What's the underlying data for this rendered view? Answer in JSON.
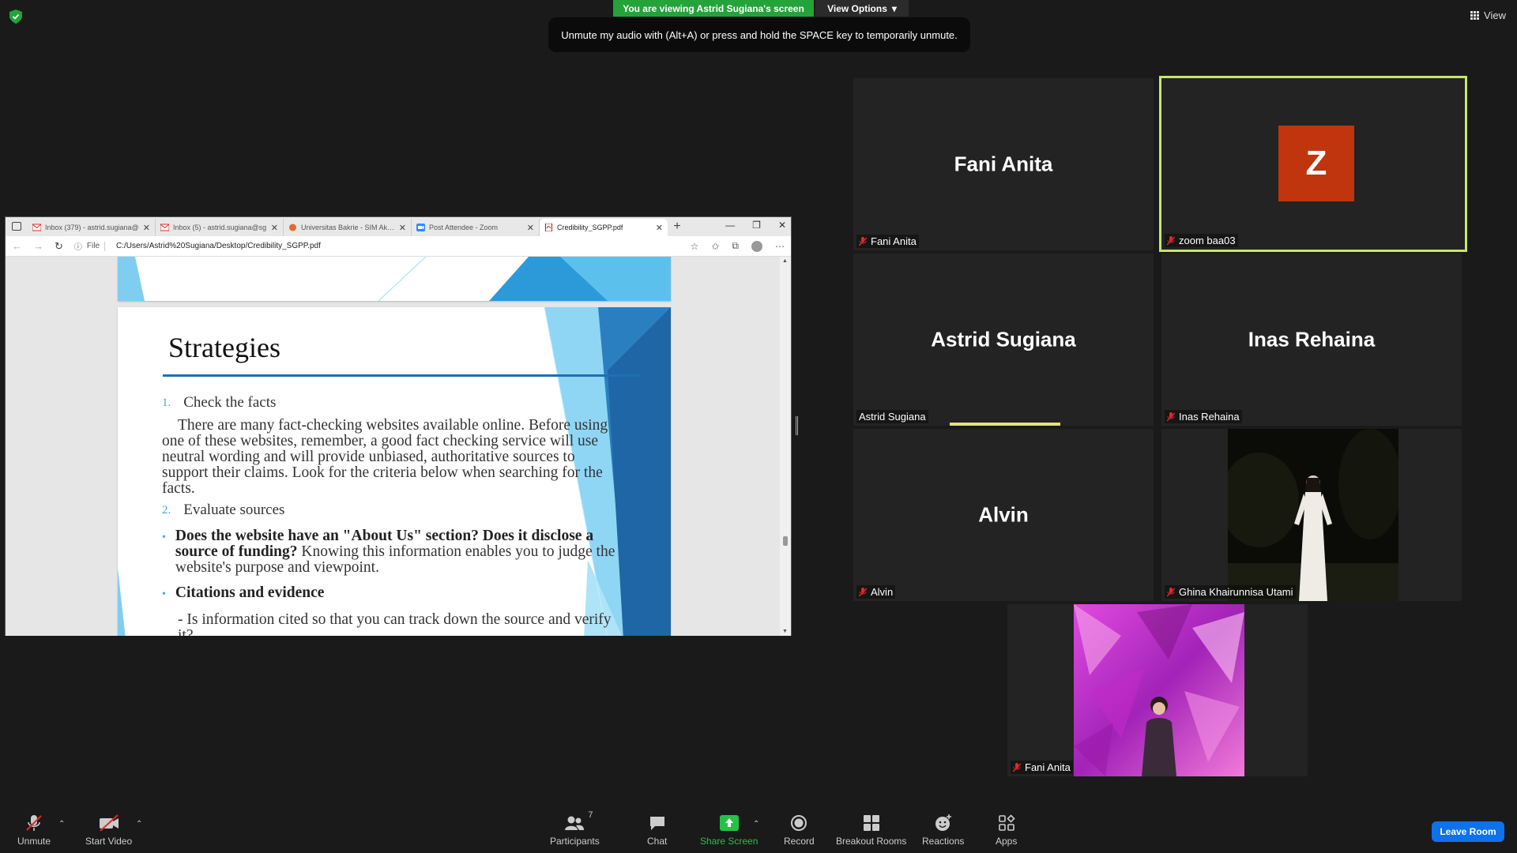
{
  "banner": {
    "viewing_text": "You are viewing Astrid Sugiana's screen",
    "view_options_label": "View Options",
    "unmute_tip": "Unmute my audio with (Alt+A) or press and hold the SPACE key to temporarily unmute.",
    "view_label": "View"
  },
  "browser": {
    "tabs": [
      {
        "label": "Inbox (379) - astrid.sugiana@",
        "icon": "gmail-icon"
      },
      {
        "label": "Inbox (5) - astrid.sugiana@sg",
        "icon": "gmail-icon"
      },
      {
        "label": "Universitas Bakrie - SIM Akad",
        "icon": "bakrie-icon"
      },
      {
        "label": "Post Attendee - Zoom",
        "icon": "zoom-icon"
      },
      {
        "label": "Credibility_SGPP.pdf",
        "icon": "pdf-icon"
      }
    ],
    "file_label": "File",
    "url": "C:/Users/Astrid%20Sugiana/Desktop/Credibility_SGPP.pdf"
  },
  "slide": {
    "title": "Strategies",
    "item1_num": "1.",
    "item1_label": "Check the facts",
    "para": "There are many fact-checking websites available online. Before using one of these websites, remember, a good fact checking service will use neutral wording and will provide unbiased, authoritative sources to support their claims. Look for the criteria below when searching for the facts.",
    "item2_num": "2.",
    "item2_label": "Evaluate sources",
    "bullet1_bold": "Does the website have an \"About Us\" section? Does it disclose a source of funding?",
    "bullet1_rest": " Knowing this information enables you to judge the website's purpose and viewpoint.",
    "bullet2_bold": "Citations and evidence",
    "sub": "- Is information cited so that you can track down the source and verify it?"
  },
  "participants": [
    {
      "name": "Fani Anita",
      "label": "Fani Anita",
      "muted": true
    },
    {
      "name": "Z",
      "label": "zoom baa03",
      "muted": true,
      "avatar_color": "#c0340e"
    },
    {
      "name": "Astrid Sugiana",
      "label": "Astrid Sugiana",
      "muted": false
    },
    {
      "name": "Inas Rehaina",
      "label": "Inas Rehaina",
      "muted": true
    },
    {
      "name": "Alvin",
      "label": "Alvin",
      "muted": true
    },
    {
      "name": "Ghina Khairunnisa Utami",
      "label": "Ghina Khairunnisa Utami",
      "muted": true
    },
    {
      "name": "Fani Anita",
      "label": "Fani Anita",
      "muted": true
    }
  ],
  "toolbar": {
    "unmute": "Unmute",
    "start_video": "Start Video",
    "participants": "Participants",
    "participants_count": "7",
    "chat": "Chat",
    "share_screen": "Share Screen",
    "record": "Record",
    "breakout_rooms": "Breakout Rooms",
    "reactions": "Reactions",
    "apps": "Apps",
    "leave": "Leave Room"
  },
  "colors": {
    "banner_green": "#24a33b",
    "active_border": "#c5e76a",
    "leave_blue": "#0e72ed",
    "share_green": "#25c24a"
  }
}
